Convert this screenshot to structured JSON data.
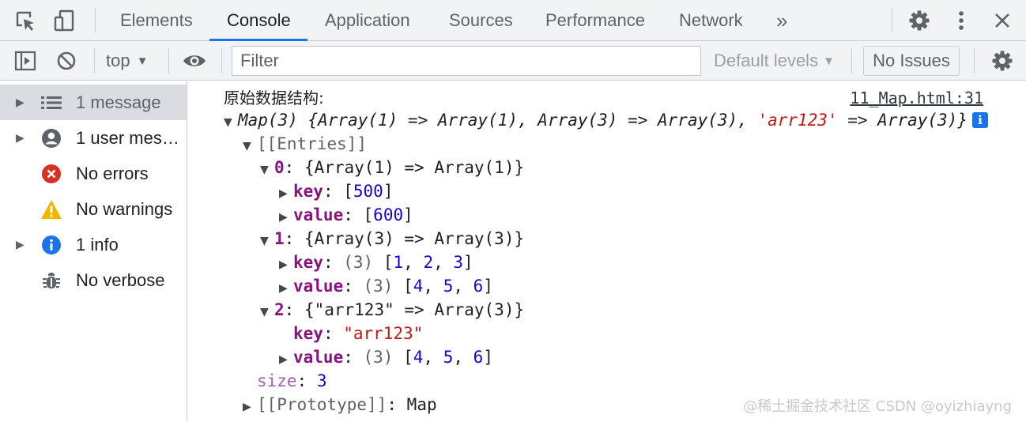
{
  "tabs": {
    "elements": "Elements",
    "console": "Console",
    "application": "Application",
    "sources": "Sources",
    "performance": "Performance",
    "network": "Network",
    "more": "»"
  },
  "toolbar": {
    "context": "top",
    "filter_placeholder": "Filter",
    "levels": "Default levels",
    "issues": "No Issues"
  },
  "sidebar": {
    "items": [
      {
        "label": "1 message",
        "icon": "list-icon"
      },
      {
        "label": "1 user mess…",
        "icon": "user-icon"
      },
      {
        "label": "No errors",
        "icon": "error-icon"
      },
      {
        "label": "No warnings",
        "icon": "warning-icon"
      },
      {
        "label": "1 info",
        "icon": "info-icon"
      },
      {
        "label": "No verbose",
        "icon": "bug-icon"
      }
    ]
  },
  "console": {
    "log_label": "原始数据结构:",
    "source_link": "11_Map.html:31",
    "map_summary_a": "Map(3) {Array(1) => Array(1), Array(3) => Array(3), ",
    "map_summary_str": "'arr123'",
    "map_summary_b": " => Array(3)}",
    "entries": "[[Entries]]",
    "entry0": {
      "index": "0",
      "summary": "{Array(1) => Array(1)}",
      "key_label": "key",
      "key_value": "[500]",
      "value_label": "value",
      "value_value": "[600]"
    },
    "entry1": {
      "index": "1",
      "summary": "{Array(3) => Array(3)}",
      "key_label": "key",
      "key_count": "(3)",
      "key_value": "[1, 2, 3]",
      "value_label": "value",
      "value_count": "(3)",
      "value_value": "[4, 5, 6]"
    },
    "entry2": {
      "index": "2",
      "summary": "{\"arr123\" => Array(3)}",
      "key_label": "key",
      "key_value": "\"arr123\"",
      "value_label": "value",
      "value_count": "(3)",
      "value_value": "[4, 5, 6]"
    },
    "size_label": "size",
    "size_value": "3",
    "prototype_label": "[[Prototype]]",
    "prototype_value": "Map"
  },
  "watermark": "@稀土掘金技术社区 CSDN @oyizhiayng"
}
